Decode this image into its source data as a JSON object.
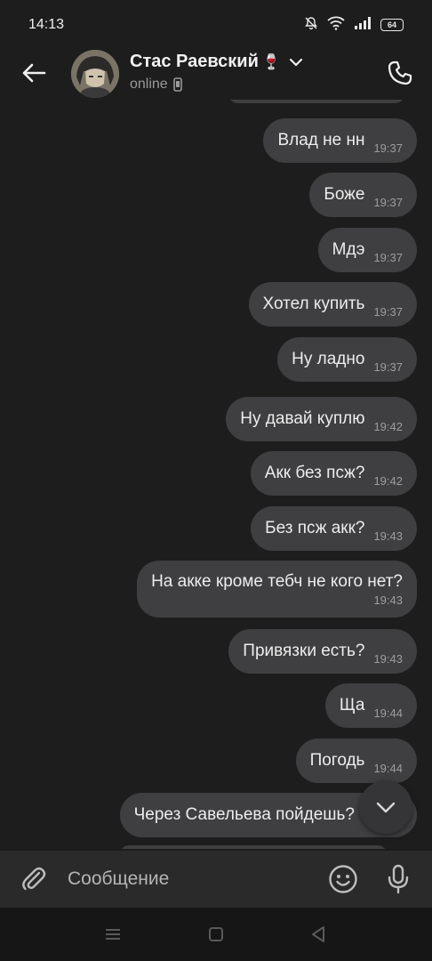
{
  "status_bar": {
    "time": "14:13",
    "battery": "64"
  },
  "header": {
    "contact_name": "Стас Раевский",
    "name_emoji": "🍷",
    "status": "online",
    "icons": {
      "back": "arrow-left-icon",
      "call": "phone-icon",
      "dropdown": "chevron-down-icon",
      "device": "mobile-device-icon"
    }
  },
  "messages": [
    {
      "text": "Влад не нн",
      "time": "19:37"
    },
    {
      "text": "Боже",
      "time": "19:37"
    },
    {
      "text": "Мдэ",
      "time": "19:37"
    },
    {
      "text": "Хотел купить",
      "time": "19:37"
    },
    {
      "text": "Ну ладно",
      "time": "19:37"
    },
    {
      "text": "Ну давай куплю",
      "time": "19:42"
    },
    {
      "text": "Акк без псж?",
      "time": "19:42"
    },
    {
      "text": "Без псж акк?",
      "time": "19:43"
    },
    {
      "text": "На акке кроме тебч не кого нет?",
      "time": "19:43"
    },
    {
      "text": "Привязки есть?",
      "time": "19:43"
    },
    {
      "text": "Ща",
      "time": "19:44"
    },
    {
      "text": "Погодь",
      "time": "19:44"
    },
    {
      "text": "Через Савельева пойдешь?",
      "time": ""
    }
  ],
  "composer": {
    "placeholder": "Сообщение",
    "icons": {
      "attach": "paperclip-icon",
      "emoji": "smiley-icon",
      "mic": "microphone-icon"
    }
  },
  "colors": {
    "background": "#1d1d1d",
    "bubble": "#3f3f41",
    "composer": "#2a2a2b",
    "nav_bar": "#161616"
  }
}
